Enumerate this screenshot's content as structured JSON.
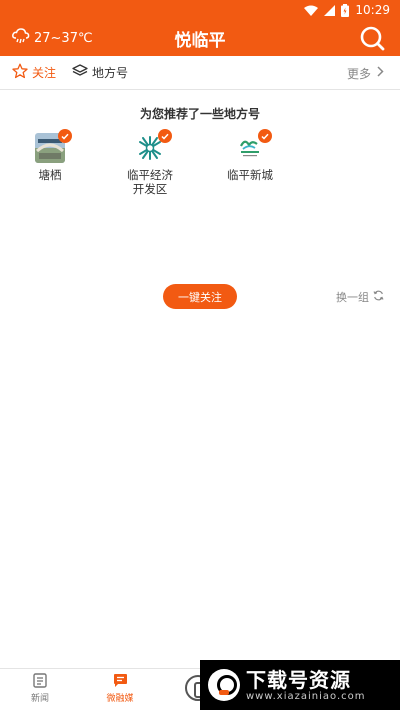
{
  "status_bar": {
    "time": "10:29"
  },
  "header": {
    "weather": "27~37℃",
    "title": "悦临平"
  },
  "tabs": [
    {
      "label": "关注",
      "icon": "star-icon",
      "active": true
    },
    {
      "label": "地方号",
      "icon": "layers-icon",
      "active": false
    }
  ],
  "more_label": "更多",
  "recommend": {
    "heading": "为您推荐了一些地方号",
    "items": [
      {
        "label": "塘栖",
        "checked": true
      },
      {
        "label": "临平经济\n开发区",
        "checked": true
      },
      {
        "label": "临平新城",
        "checked": true
      }
    ]
  },
  "follow_all_label": "一键关注",
  "swap_label": "换一组",
  "bottom_nav": [
    {
      "label": "新闻",
      "icon": "news-icon",
      "active": false
    },
    {
      "label": "微融媒",
      "icon": "chat-icon",
      "active": true
    }
  ],
  "watermark": {
    "title": "下载号资源",
    "url": "www.xiazainiao.com"
  },
  "colors": {
    "accent": "#f25a12"
  }
}
